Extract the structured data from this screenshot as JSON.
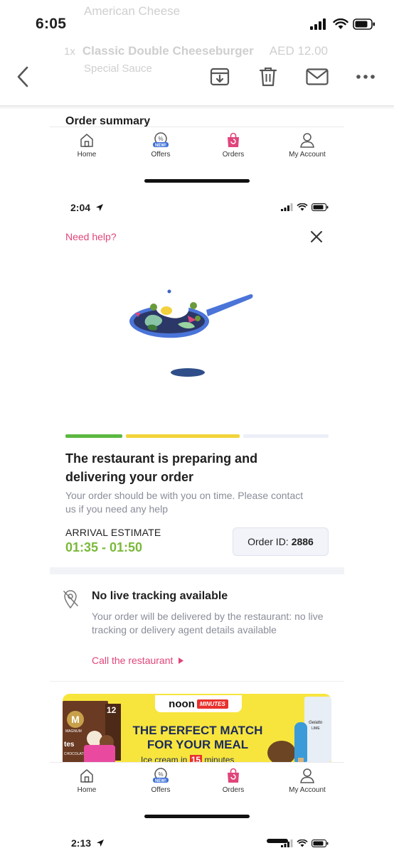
{
  "outer_status": {
    "time": "6:05"
  },
  "mail_toolbar": {
    "ghost_line1": "American Cheese",
    "ghost_qty": "1x",
    "ghost_item": "Classic Double Cheeseburger",
    "ghost_price": "AED 12.00",
    "ghost_sauce": "Special Sauce",
    "icons": [
      "back-chevron-icon",
      "archive-icon",
      "trash-icon",
      "mail-icon",
      "more-icon"
    ]
  },
  "screenshot1": {
    "section_title": "Order summary",
    "nav": [
      {
        "label": "Home",
        "icon": "home-icon"
      },
      {
        "label": "Offers",
        "icon": "offers-icon",
        "badge": "NEW!"
      },
      {
        "label": "Orders",
        "icon": "orders-bag-icon"
      },
      {
        "label": "My Account",
        "icon": "account-icon"
      }
    ]
  },
  "screenshot2": {
    "status_time": "2:04",
    "help_link": "Need help?",
    "progress_colors": [
      "#5cb842",
      "#f2d43a",
      "#eceff7"
    ],
    "title": "The restaurant is preparing and delivering your order",
    "subtitle": "Your order should be with you on time. Please contact us if you need any help",
    "arrival_label": "ARRIVAL ESTIMATE",
    "arrival_time": "01:35 - 01:50",
    "order_id_label": "Order ID:",
    "order_id": "2886",
    "tracking_title": "No live tracking available",
    "tracking_text": "Your order will be delivered by the restaurant: no live tracking or delivery agent details available",
    "call_link": "Call the restaurant",
    "banner": {
      "brand": "noon",
      "brand_tag": "MINUTES",
      "line1": "THE PERFECT MATCH",
      "line2": "FOR YOUR MEAL",
      "line3_prefix": "Ice cream in ",
      "line3_number": "15",
      "line3_suffix": " minutes",
      "box_letter": "M",
      "box_brand": "MAGNUM",
      "box_text": "tes",
      "box_sub": "CHOCOLATE",
      "box_count": "12",
      "popsicle_brand": "Gelatto",
      "popsicle_flavor": "LIME"
    },
    "nav": [
      {
        "label": "Home"
      },
      {
        "label": "Offers",
        "badge": "NEW!"
      },
      {
        "label": "Orders"
      },
      {
        "label": "My Account"
      }
    ]
  },
  "screenshot3": {
    "status_time": "2:13"
  },
  "colors": {
    "accent_pink": "#e0457b",
    "arrival_green": "#7ab93a",
    "banner_yellow": "#f7e53d"
  }
}
